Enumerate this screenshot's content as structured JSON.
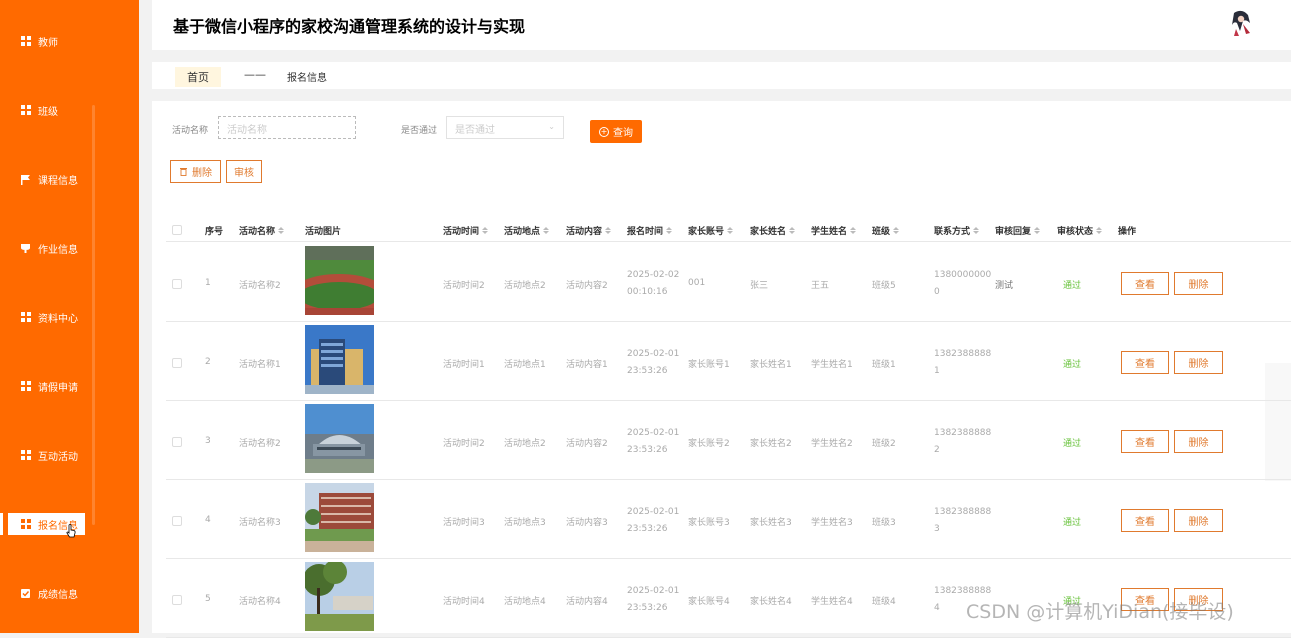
{
  "sidebar": {
    "items": [
      {
        "label": "教师",
        "icon": "grid-icon"
      },
      {
        "label": "班级",
        "icon": "grid-icon"
      },
      {
        "label": "课程信息",
        "icon": "flag-icon"
      },
      {
        "label": "作业信息",
        "icon": "cup-icon"
      },
      {
        "label": "资料中心",
        "icon": "grid-icon"
      },
      {
        "label": "请假申请",
        "icon": "grid-icon"
      },
      {
        "label": "互动活动",
        "icon": "grid-icon"
      },
      {
        "label": "报名信息",
        "icon": "grid-icon",
        "active": true
      },
      {
        "label": "成绩信息",
        "icon": "check-square-icon"
      }
    ],
    "accent": "#ff6a00"
  },
  "header": {
    "title": "基于微信小程序的家校沟通管理系统的设计与实现"
  },
  "breadcrumb": {
    "home": "首页",
    "separator": "——",
    "current": "报名信息"
  },
  "filters": {
    "activity_label": "活动名称",
    "activity_placeholder": "活动名称",
    "approved_label": "是否通过",
    "approved_placeholder": "是否通过",
    "search_label": "查询"
  },
  "toolbar": {
    "delete_label": "删除",
    "audit_label": "审核"
  },
  "table": {
    "columns": [
      "序号",
      "活动名称",
      "活动图片",
      "活动时间",
      "活动地点",
      "活动内容",
      "报名时间",
      "家长账号",
      "家长姓名",
      "学生姓名",
      "班级",
      "联系方式",
      "审核回复",
      "审核状态",
      "操作"
    ],
    "view_label": "查看",
    "delete_label": "删除",
    "rows": [
      {
        "no": "1",
        "name": "活动名称2",
        "image": "stadium",
        "time": "活动时间2",
        "place": "活动地点2",
        "content": "活动内容2",
        "signup_time": "2025-02-02 00:10:16",
        "parent_account": "001",
        "parent_name": "张三",
        "student_name": "王五",
        "class": "班级5",
        "phone": "13800000000",
        "reply": "测试",
        "status": "通过"
      },
      {
        "no": "2",
        "name": "活动名称1",
        "image": "building",
        "time": "活动时间1",
        "place": "活动地点1",
        "content": "活动内容1",
        "signup_time": "2025-02-01 23:53:26",
        "parent_account": "家长账号1",
        "parent_name": "家长姓名1",
        "student_name": "学生姓名1",
        "class": "班级1",
        "phone": "13823888881",
        "reply": "",
        "status": "通过"
      },
      {
        "no": "3",
        "name": "活动名称2",
        "image": "hall",
        "time": "活动时间2",
        "place": "活动地点2",
        "content": "活动内容2",
        "signup_time": "2025-02-01 23:53:26",
        "parent_account": "家长账号2",
        "parent_name": "家长姓名2",
        "student_name": "学生姓名2",
        "class": "班级2",
        "phone": "13823888882",
        "reply": "",
        "status": "通过"
      },
      {
        "no": "4",
        "name": "活动名称3",
        "image": "campus",
        "time": "活动时间3",
        "place": "活动地点3",
        "content": "活动内容3",
        "signup_time": "2025-02-01 23:53:26",
        "parent_account": "家长账号3",
        "parent_name": "家长姓名3",
        "student_name": "学生姓名3",
        "class": "班级3",
        "phone": "13823888883",
        "reply": "",
        "status": "通过"
      },
      {
        "no": "5",
        "name": "活动名称4",
        "image": "trees",
        "time": "活动时间4",
        "place": "活动地点4",
        "content": "活动内容4",
        "signup_time": "2025-02-01 23:53:26",
        "parent_account": "家长账号4",
        "parent_name": "家长姓名4",
        "student_name": "学生姓名4",
        "class": "班级4",
        "phone": "13823888884",
        "reply": "",
        "status": "通过"
      }
    ]
  },
  "watermark": "CSDN @计算机YiDian(接毕设)"
}
